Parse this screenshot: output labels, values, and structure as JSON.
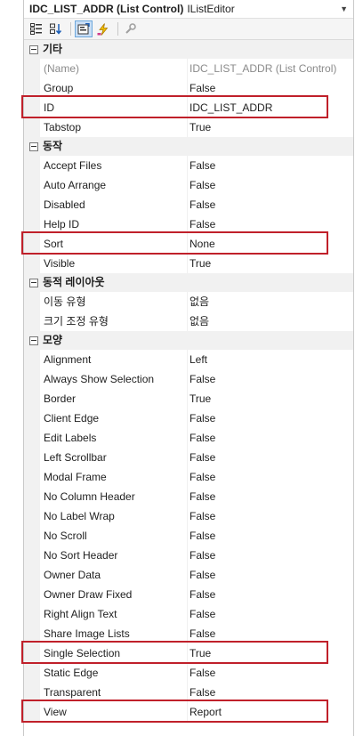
{
  "header": {
    "title": "IDC_LIST_ADDR (List Control)",
    "type": "IListEditor",
    "dropdown_glyph": "▼"
  },
  "toolbar": {
    "buttons": [
      {
        "icon": "categorized-icon",
        "active": true
      },
      {
        "icon": "alphabetical-icon",
        "active": false
      },
      {
        "icon": "properties-icon",
        "active": true
      },
      {
        "icon": "events-icon",
        "active": false
      },
      {
        "icon": "property-pages-icon",
        "active": false
      }
    ]
  },
  "categories": [
    {
      "name": "기타",
      "rows": [
        {
          "name": "(Name)",
          "value": "IDC_LIST_ADDR (List Control)",
          "readonly": true
        },
        {
          "name": "Group",
          "value": "False"
        },
        {
          "name": "ID",
          "value": "IDC_LIST_ADDR",
          "highlighted": true
        },
        {
          "name": "Tabstop",
          "value": "True"
        }
      ]
    },
    {
      "name": "동작",
      "rows": [
        {
          "name": "Accept Files",
          "value": "False"
        },
        {
          "name": "Auto Arrange",
          "value": "False"
        },
        {
          "name": "Disabled",
          "value": "False"
        },
        {
          "name": "Help ID",
          "value": "False"
        },
        {
          "name": "Sort",
          "value": "None",
          "highlighted": true
        },
        {
          "name": "Visible",
          "value": "True"
        }
      ]
    },
    {
      "name": "동적 레이아웃",
      "rows": [
        {
          "name": "이동 유형",
          "value": "없음"
        },
        {
          "name": "크기 조정 유형",
          "value": "없음"
        }
      ]
    },
    {
      "name": "모양",
      "rows": [
        {
          "name": "Alignment",
          "value": "Left"
        },
        {
          "name": "Always Show Selection",
          "value": "False"
        },
        {
          "name": "Border",
          "value": "True"
        },
        {
          "name": "Client Edge",
          "value": "False"
        },
        {
          "name": "Edit Labels",
          "value": "False"
        },
        {
          "name": "Left Scrollbar",
          "value": "False"
        },
        {
          "name": "Modal Frame",
          "value": "False"
        },
        {
          "name": "No Column Header",
          "value": "False"
        },
        {
          "name": "No Label Wrap",
          "value": "False"
        },
        {
          "name": "No Scroll",
          "value": "False"
        },
        {
          "name": "No Sort Header",
          "value": "False"
        },
        {
          "name": "Owner Data",
          "value": "False"
        },
        {
          "name": "Owner Draw Fixed",
          "value": "False"
        },
        {
          "name": "Right Align Text",
          "value": "False"
        },
        {
          "name": "Share Image Lists",
          "value": "False"
        },
        {
          "name": "Single Selection",
          "value": "True",
          "highlighted": true
        },
        {
          "name": "Static Edge",
          "value": "False"
        },
        {
          "name": "Transparent",
          "value": "False"
        },
        {
          "name": "View",
          "value": "Report",
          "highlighted": true
        }
      ]
    }
  ],
  "colors": {
    "highlight_border": "#c0202a",
    "category_bg": "#f1f1f1",
    "toolbar_active": "#c9def5"
  }
}
